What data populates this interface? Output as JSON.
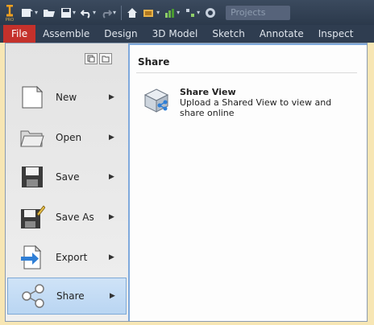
{
  "app": {
    "project_field": "Projects"
  },
  "tabs": [
    {
      "label": "File",
      "active": true
    },
    {
      "label": "Assemble"
    },
    {
      "label": "Design"
    },
    {
      "label": "3D Model"
    },
    {
      "label": "Sketch"
    },
    {
      "label": "Annotate"
    },
    {
      "label": "Inspect"
    }
  ],
  "menu": {
    "items": [
      {
        "label": "New",
        "icon": "new-document-icon"
      },
      {
        "label": "Open",
        "icon": "open-folder-icon"
      },
      {
        "label": "Save",
        "icon": "save-disk-icon"
      },
      {
        "label": "Save As",
        "icon": "save-as-icon"
      },
      {
        "label": "Export",
        "icon": "export-icon"
      },
      {
        "label": "Share",
        "icon": "share-icon",
        "selected": true
      }
    ],
    "arrow": "▶"
  },
  "share_panel": {
    "title": "Share",
    "option": {
      "name": "Share View",
      "description": "Upload a Shared View to view and share online",
      "icon": "shared-view-icon"
    }
  },
  "colors": {
    "file_tab": "#c4312b",
    "selection": "#b9d5f2",
    "accent_border": "#7fa9dc"
  }
}
